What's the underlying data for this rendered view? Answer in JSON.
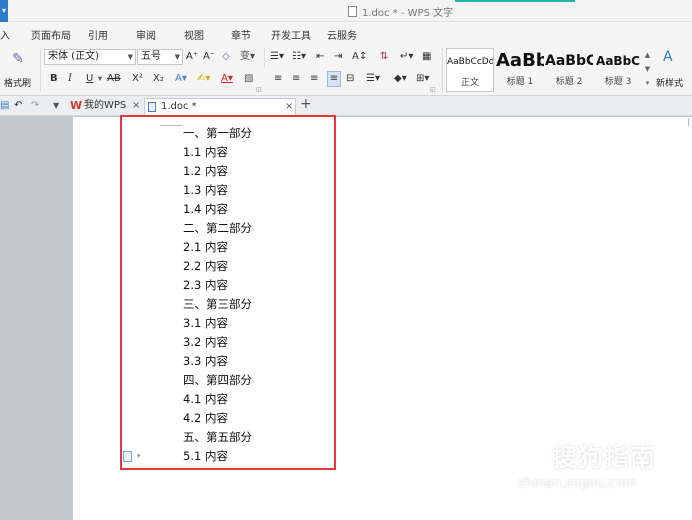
{
  "window": {
    "title": "1.doc * - WPS 文字",
    "app_button": "▾"
  },
  "menu": [
    "入",
    "页面布局",
    "引用",
    "审阅",
    "视图",
    "章节",
    "开发工具",
    "云服务"
  ],
  "ribbon": {
    "format_painter_label": "格式刷",
    "font_name": "宋体 (正文)",
    "font_size": "五号",
    "grow_font": "A⁺",
    "shrink_font": "A⁻",
    "bold": "B",
    "italic": "I",
    "underline": "U",
    "strikethrough": "AB",
    "superscript": "X²",
    "subscript": "X₂",
    "styles": [
      {
        "preview": "AaBbCcDd",
        "label": "正文"
      },
      {
        "preview": "AaBb",
        "label": "标题 1"
      },
      {
        "preview": "AaBbC",
        "label": "标题 2"
      },
      {
        "preview": "AaBbC",
        "label": "标题 3"
      }
    ],
    "new_style_label": "新样式"
  },
  "tabs": [
    {
      "label": "我的WPS",
      "close": "×"
    },
    {
      "label": "1.doc *",
      "close": "×"
    }
  ],
  "new_tab": "+",
  "document": {
    "lines": [
      "一、第一部分",
      "1.1 内容",
      "1.2 内容",
      "1.3 内容",
      "1.4 内容",
      "二、第二部分",
      "2.1 内容",
      "2.2 内容",
      "2.3 内容",
      "三、第三部分",
      "3.1 内容",
      "3.2 内容",
      "3.3 内容",
      "四、第四部分",
      "4.1 内容",
      "4.2 内容",
      "五、第五部分",
      "5.1 内容"
    ]
  },
  "watermark": {
    "text": "搜狗指南",
    "url": "zhinan.sogou.com"
  },
  "colors": {
    "highlight_box": "#e0393b",
    "accent": "#1fb3a4",
    "wps_logo": "#d23a2a"
  }
}
